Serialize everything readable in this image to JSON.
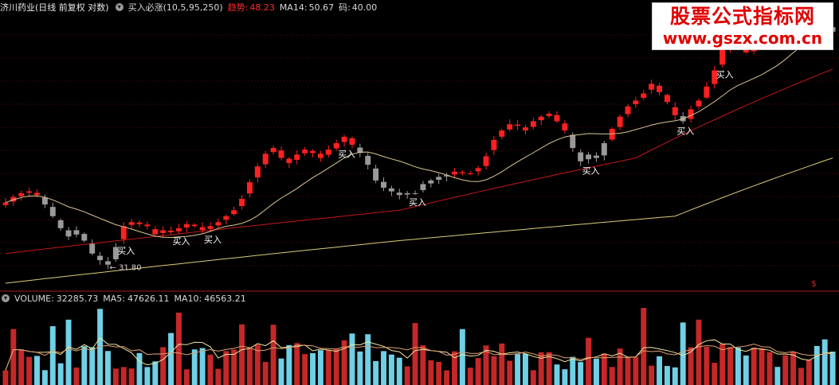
{
  "header": {
    "stock": "济川药业(日线 前复权 对数)",
    "indicator": "买入必涨(10,5,95,250)",
    "trend_label": "趋势:",
    "trend_value": "48.23",
    "ma_label": "MA14:",
    "ma_value": "50.67",
    "code_label": "码:",
    "code_value": "40.00"
  },
  "volume_header": {
    "label": "VOLUME:",
    "value": "32285.73",
    "ma5_label": "MA5:",
    "ma5_value": "47626.11",
    "ma10_label": "MA10:",
    "ma10_value": "46563.21"
  },
  "watermark": {
    "line1": "股票公式指标网",
    "line2": "www.gszx.com.cn"
  },
  "colors": {
    "up": "#ff2020",
    "down": "#9a9a9a",
    "ma_short": "#d8c690",
    "trend": "#c41818",
    "long": "#dccc78",
    "vol_up": "#c42828",
    "vol_down": "#6fd0e6",
    "sep": "#b01818"
  },
  "chart_data": [
    {
      "type": "candlestick",
      "title": "",
      "xlabel": "",
      "ylabel": "",
      "scale": "log",
      "ylim": [
        30,
        64
      ],
      "grid": true,
      "key_points": [
        {
          "label": "31.80",
          "index": 13,
          "price": 31.8
        },
        {
          "label": "",
          "index": 43,
          "price": 46.0
        },
        {
          "label": "",
          "index": 131,
          "price": 62.5
        }
      ],
      "buy_signals": [
        {
          "index": 15,
          "label": "买入"
        },
        {
          "index": 22,
          "label": "买入"
        },
        {
          "index": 26,
          "label": "买入"
        },
        {
          "index": 43,
          "label": "买入"
        },
        {
          "index": 52,
          "label": "买入"
        },
        {
          "index": 74,
          "label": "买入"
        },
        {
          "index": 86,
          "label": "买入"
        },
        {
          "index": 91,
          "label": "买入"
        }
      ],
      "series": [
        {
          "name": "MA14",
          "kind": "moving_average",
          "period": 14
        },
        {
          "name": "趋势",
          "kind": "trend_line",
          "values_at": [
            [
              0,
              33.0
            ],
            [
              50,
              37.2
            ],
            [
              80,
              43.0
            ],
            [
              105,
              55.0
            ]
          ]
        },
        {
          "name": "",
          "kind": "long_line",
          "values_at": [
            [
              0,
              30.4
            ],
            [
              50,
              34.2
            ],
            [
              85,
              36.6
            ],
            [
              105,
              43.0
            ]
          ]
        }
      ],
      "closes": [
        38.0,
        38.6,
        39.0,
        39.2,
        38.8,
        37.8,
        36.6,
        35.4,
        34.6,
        35.2,
        34.2,
        33.0,
        32.4,
        32.0,
        33.6,
        35.6,
        36.0,
        35.8,
        35.6,
        34.8,
        35.2,
        35.0,
        35.4,
        35.8,
        35.6,
        35.2,
        35.6,
        36.0,
        36.6,
        37.2,
        38.4,
        40.2,
        42.0,
        43.5,
        44.2,
        43.0,
        42.4,
        43.4,
        44.0,
        43.6,
        43.0,
        44.0,
        44.8,
        45.6,
        44.6,
        43.6,
        42.2,
        40.4,
        39.6,
        39.2,
        38.8,
        39.0,
        39.0,
        40.0,
        40.4,
        40.8,
        41.0,
        41.4,
        41.2,
        41.2,
        41.8,
        43.2,
        45.2,
        46.4,
        47.2,
        47.0,
        46.4,
        47.6,
        48.2,
        48.6,
        47.6,
        46.4,
        44.2,
        42.6,
        43.4,
        43.0,
        44.8,
        46.6,
        48.2,
        49.6,
        50.4,
        51.4,
        52.8,
        51.6,
        50.2,
        48.4,
        47.6,
        49.2,
        50.4,
        52.4,
        54.8,
        58.0,
        60.0,
        58.8,
        57.6,
        58.8,
        60.4,
        61.2,
        60.2,
        61.4,
        62.6,
        63.8,
        64.2,
        62.8,
        62.0,
        61.0
      ],
      "volume": {
        "label": "VOLUME",
        "ma5_value": 47626.11,
        "ma10_value": 46563.21,
        "last_value": 32285.73
      }
    }
  ]
}
